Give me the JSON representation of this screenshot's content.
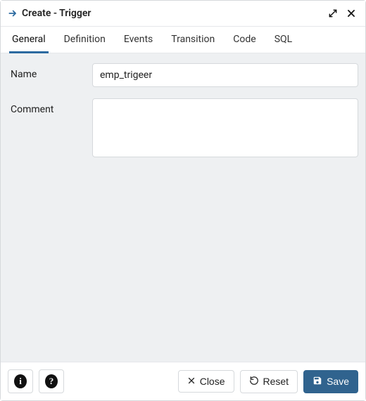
{
  "header": {
    "title": "Create - Trigger"
  },
  "tabs": [
    {
      "label": "General",
      "active": true
    },
    {
      "label": "Definition",
      "active": false
    },
    {
      "label": "Events",
      "active": false
    },
    {
      "label": "Transition",
      "active": false
    },
    {
      "label": "Code",
      "active": false
    },
    {
      "label": "SQL",
      "active": false
    }
  ],
  "form": {
    "name_label": "Name",
    "name_value": "emp_trigeer",
    "comment_label": "Comment",
    "comment_value": ""
  },
  "footer": {
    "info_glyph": "i",
    "help_glyph": "?",
    "close_label": "Close",
    "reset_label": "Reset",
    "save_label": "Save"
  }
}
